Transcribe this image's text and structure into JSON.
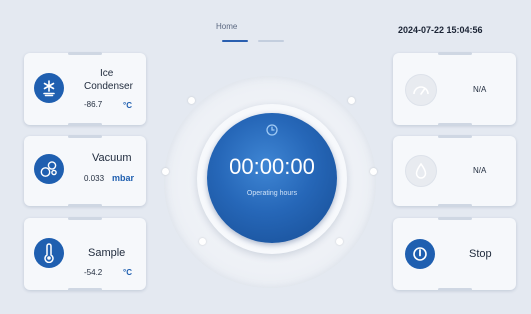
{
  "header": {
    "tab_home": "Home",
    "datetime": "2024-07-22 15:04:56"
  },
  "left_cards": {
    "ice_condenser": {
      "label_line1": "Ice",
      "label_line2": "Condenser",
      "value": "-86.7",
      "unit": "°C",
      "icon": "snowflake-icon"
    },
    "vacuum": {
      "label": "Vacuum",
      "value": "0.033",
      "unit": "mbar",
      "icon": "vacuum-bubbles-icon"
    },
    "sample": {
      "label": "Sample",
      "value": "-54.2",
      "unit": "°C",
      "icon": "thermometer-icon"
    }
  },
  "timer": {
    "value": "00:00:00",
    "caption": "Operating hours",
    "icon": "clock-icon"
  },
  "right_cards": {
    "gauge": {
      "value": "N/A",
      "icon": "gauge-icon"
    },
    "drop": {
      "value": "N/A",
      "icon": "water-drop-icon"
    },
    "stop": {
      "label": "Stop",
      "icon": "power-icon"
    }
  },
  "colors": {
    "accent": "#1f5fb0",
    "background": "#e4e9f1",
    "card": "#f6f8fb"
  }
}
